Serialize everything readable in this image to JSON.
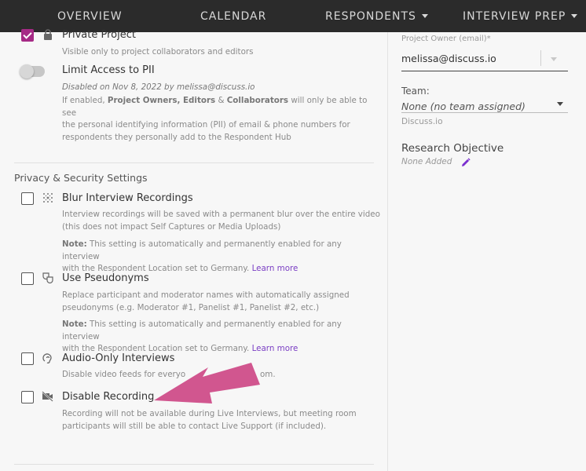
{
  "nav": {
    "items": [
      {
        "label": "OVERVIEW"
      },
      {
        "label": "CALENDAR"
      },
      {
        "label": "RESPONDENTS"
      },
      {
        "label": "INTERVIEW PREP"
      }
    ]
  },
  "project": {
    "private": {
      "label": "Private Project",
      "checked": true,
      "description": "Visible only to project collaborators and editors"
    },
    "pii": {
      "label": "Limit Access to PII",
      "enabled": false,
      "status": "Disabled on Nov 8, 2022 by melissa@discuss.io",
      "desc_prefix": "If enabled, ",
      "desc_roles_1": "Project Owners, Editors",
      "desc_amp": " & ",
      "desc_roles_2": "Collaborators",
      "desc_line1_tail": " will only be able to see",
      "desc_line2": "the personal identifying information (PII) of email & phone numbers for",
      "desc_line3": "respondents they personally add to the Respondent Hub"
    }
  },
  "privacy": {
    "heading": "Privacy & Security Settings",
    "blur": {
      "label": "Blur Interview Recordings",
      "checked": false,
      "icon": "blur-icon",
      "desc1": "Interview recordings will be saved with a permanent blur over the entire video",
      "desc2": "(this does not impact Self Captures or Media Uploads)",
      "note_label": "Note:",
      "note1": " This setting is automatically and permanently enabled for any interview",
      "note2": "with the Respondent Location set to Germany. ",
      "learn_more": "Learn more"
    },
    "pseudonyms": {
      "label": "Use Pseudonyms",
      "checked": false,
      "icon": "mask-icon",
      "desc1": "Replace participant and moderator names with automatically assigned",
      "desc2": "pseudonyms (e.g. Moderator #1, Panelist #1, Panelist #2, etc.)",
      "note_label": "Note:",
      "note1": " This setting is automatically and permanently enabled for any interview",
      "note2": "with the Respondent Location set to Germany. ",
      "learn_more": "Learn more"
    },
    "audio": {
      "label": "Audio-Only Interviews",
      "checked": false,
      "icon": "audio-icon",
      "desc_start": "Disable video feeds for everyo",
      "desc_end": "om."
    },
    "disable_recording": {
      "label": "Disable Recording",
      "checked": false,
      "icon": "video-off-icon",
      "desc1": "Recording will not be available during Live Interviews, but meeting room",
      "desc2": "participants will still be able to contact Live Support (if included)."
    }
  },
  "sidebar": {
    "owner_label": "Project Owner (email)",
    "owner_required": "*",
    "owner_value": "melissa@discuss.io",
    "team_label": "Team:",
    "team_value": "None (no team assigned)",
    "team_org": "Discuss.io",
    "objective_label": "Research Objective",
    "objective_value": "None Added"
  },
  "colors": {
    "accent": "#a62a86",
    "link": "#7b3fc4",
    "annotation_arrow": "#d1568f",
    "nav_bg": "#2b2b2b"
  }
}
